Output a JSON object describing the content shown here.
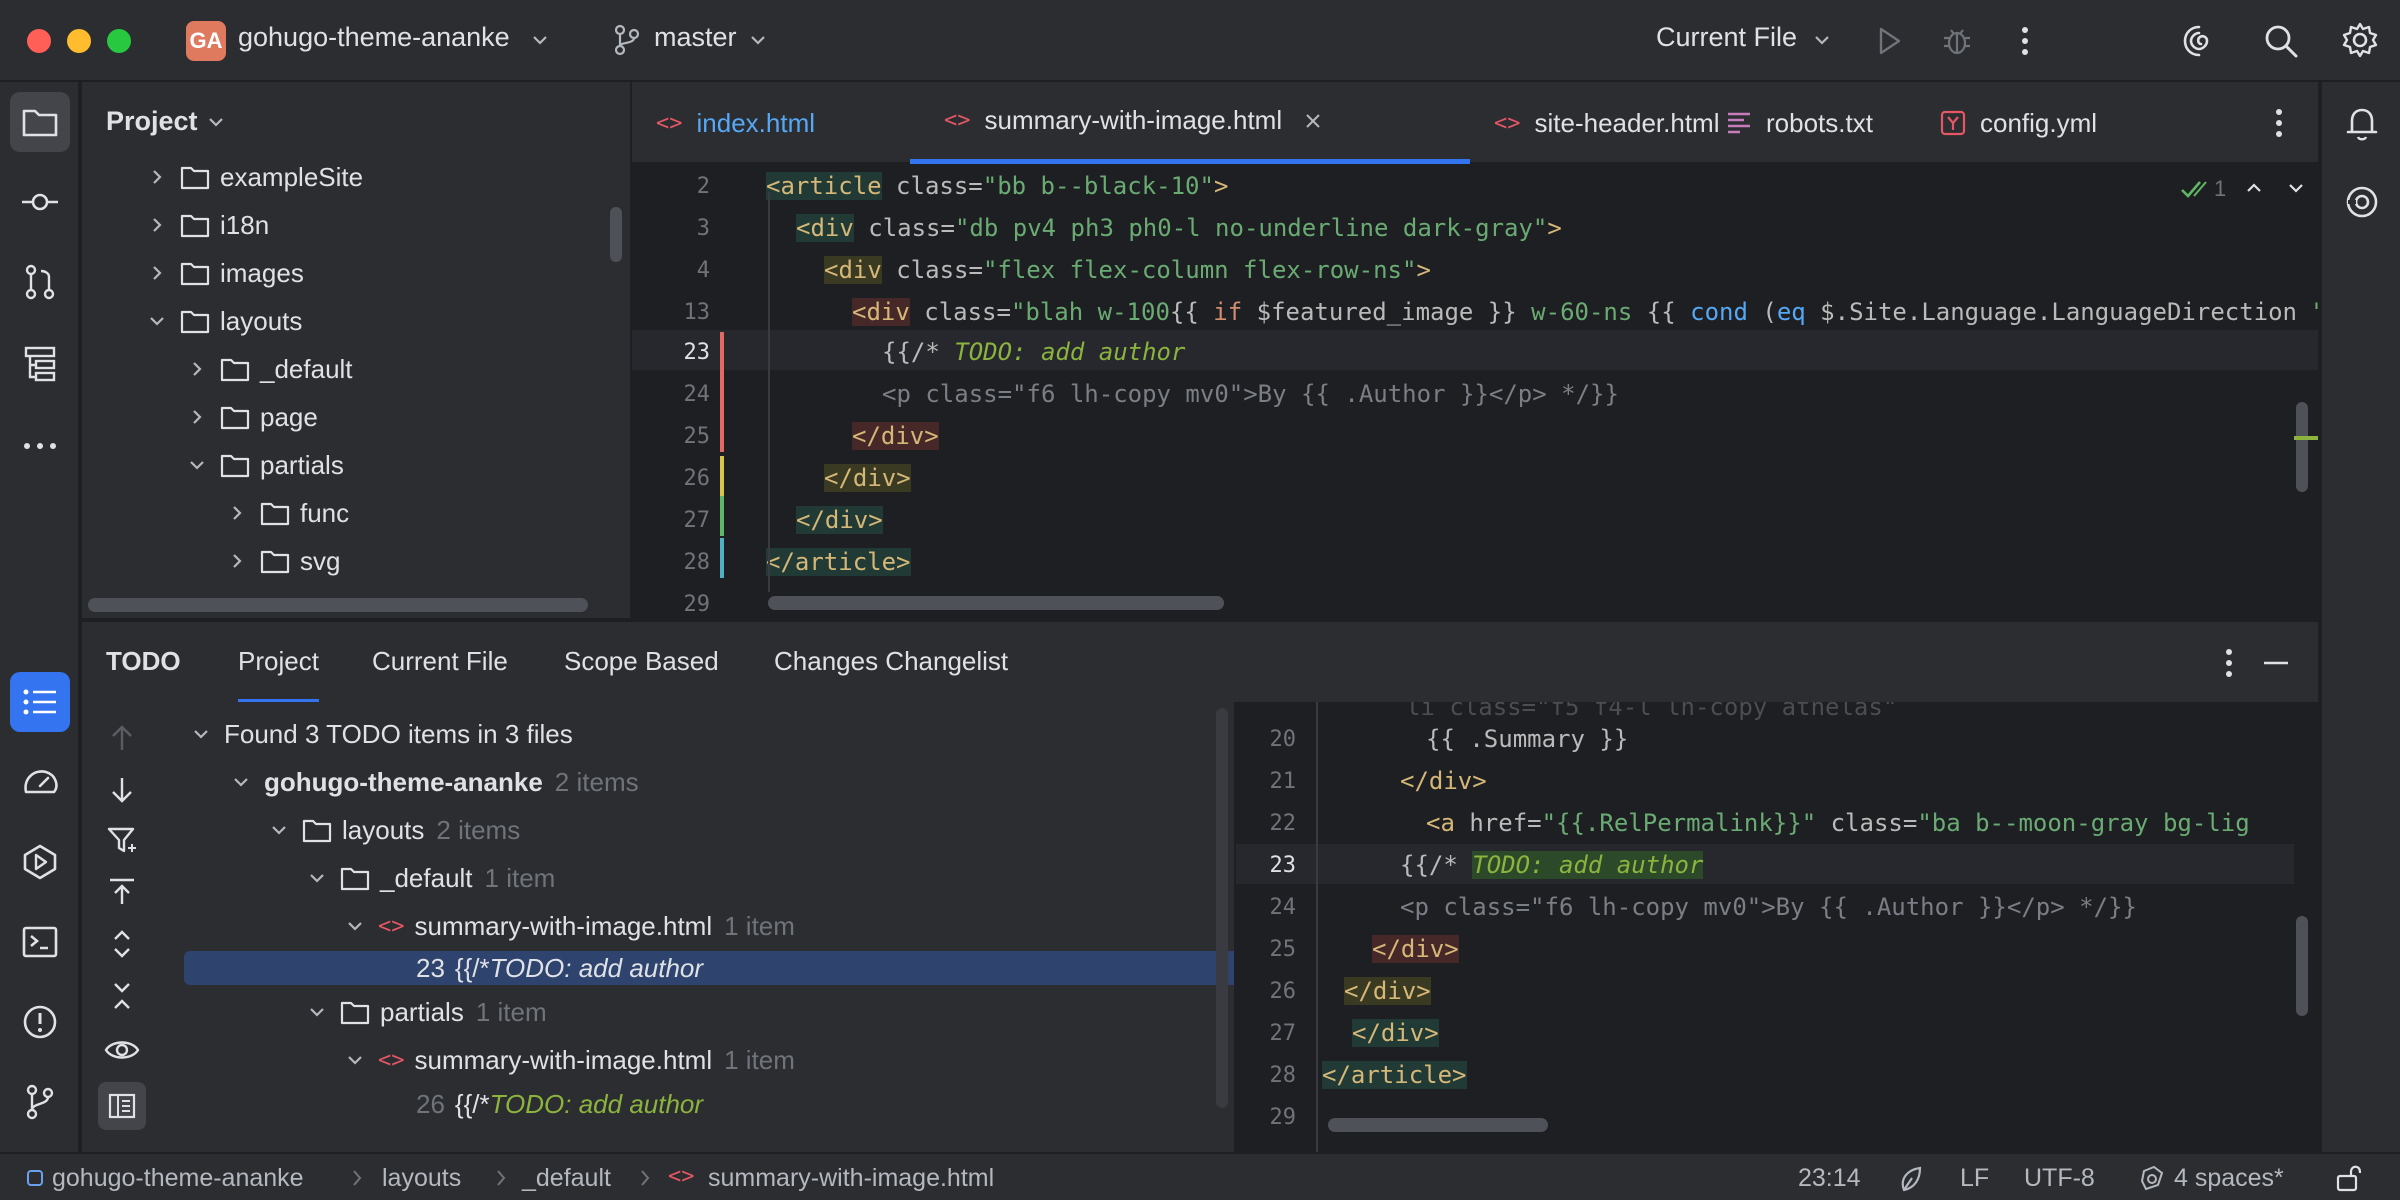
{
  "titlebar": {
    "project_badge": "GA",
    "project_name": "gohugo-theme-ananke",
    "branch": "master",
    "run_config": "Current File",
    "colors": {
      "close": "#ff5f57",
      "minimize": "#febc2e",
      "zoom": "#28c840",
      "badge": "#e07a5f"
    }
  },
  "project_panel": {
    "title": "Project",
    "items": [
      {
        "label": "exampleSite",
        "expanded": false
      },
      {
        "label": "i18n",
        "expanded": false
      },
      {
        "label": "images",
        "expanded": false
      },
      {
        "label": "layouts",
        "expanded": true
      },
      {
        "label": "_default",
        "expanded": false
      },
      {
        "label": "page",
        "expanded": false
      },
      {
        "label": "partials",
        "expanded": true
      },
      {
        "label": "func",
        "expanded": false
      },
      {
        "label": "svg",
        "expanded": false
      }
    ]
  },
  "editor": {
    "tabs": [
      {
        "label": "index.html",
        "active": false
      },
      {
        "label": "summary-with-image.html",
        "active": true
      },
      {
        "label": "site-header.html",
        "active": false
      },
      {
        "label": "robots.txt",
        "active": false
      },
      {
        "label": "config.yml",
        "active": false
      }
    ],
    "inspection_count": "1",
    "lines": [
      {
        "num": "2",
        "text": "<article class=\"bb b--black-10\">"
      },
      {
        "num": "3",
        "text": "<div class=\"db pv4 ph3 ph0-l no-underline dark-gray\">"
      },
      {
        "num": "4",
        "text": "<div class=\"flex flex-column flex-row-ns\">"
      },
      {
        "num": "13",
        "text": "<div class=\"blah w-100{{ if $featured_image }} w-60-ns {{ cond (eq $.Site.Language.LanguageDirection \""
      },
      {
        "num": "23",
        "text_a": "{{/* ",
        "text_b": "TODO: add author"
      },
      {
        "num": "24",
        "text": "<p class=\"f6 lh-copy mv0\">By {{ .Author }}</p> */}}"
      },
      {
        "num": "25",
        "text": "</div>"
      },
      {
        "num": "26",
        "text": "</div>"
      },
      {
        "num": "27",
        "text": "</div>"
      },
      {
        "num": "28",
        "text": "</article>"
      },
      {
        "num": "29",
        "text": ""
      }
    ]
  },
  "todo": {
    "title": "TODO",
    "tabs": [
      "Project",
      "Current File",
      "Scope Based",
      "Changes Changelist"
    ],
    "summary": "Found 3 TODO items in 3 files",
    "tree": {
      "root": "gohugo-theme-ananke",
      "root_count": "2 items",
      "layouts": "layouts",
      "layouts_count": "2 items",
      "default": "_default",
      "default_count": "1 item",
      "file1": "summary-with-image.html",
      "file1_count": "1 item",
      "item1_line": "23",
      "item1_prefix": "{{/* ",
      "item1_text": "TODO: add author",
      "partials": "partials",
      "partials_count": "1 item",
      "file2": "summary-with-image.html",
      "file2_count": "1 item",
      "item2_line": "26",
      "item2_prefix": "{{/* ",
      "item2_text": "TODO: add author"
    },
    "preview": [
      {
        "num": "20",
        "text": "{{ .Summary }}"
      },
      {
        "num": "21",
        "text": "</div>"
      },
      {
        "num": "22",
        "a": "<a ",
        "b": "href=",
        "c": "\"{{.RelPermalink}}\"",
        "d": " class=",
        "e": "\"ba b--moon-gray bg-lig"
      },
      {
        "num": "23",
        "a": "{{/* ",
        "b": "TODO: add author"
      },
      {
        "num": "24",
        "text": "<p class=\"f6 lh-copy mv0\">By {{ .Author }}</p> */}}"
      },
      {
        "num": "25",
        "text": "</div>"
      },
      {
        "num": "26",
        "text": "</div>"
      },
      {
        "num": "27",
        "text": "</div>"
      },
      {
        "num": "28",
        "text": "</article>"
      },
      {
        "num": "29",
        "text": ""
      }
    ]
  },
  "statusbar": {
    "breadcrumb": [
      "gohugo-theme-ananke",
      "layouts",
      "_default",
      "summary-with-image.html"
    ],
    "position": "23:14",
    "line_ending": "LF",
    "encoding": "UTF-8",
    "indent": "4 spaces*"
  }
}
